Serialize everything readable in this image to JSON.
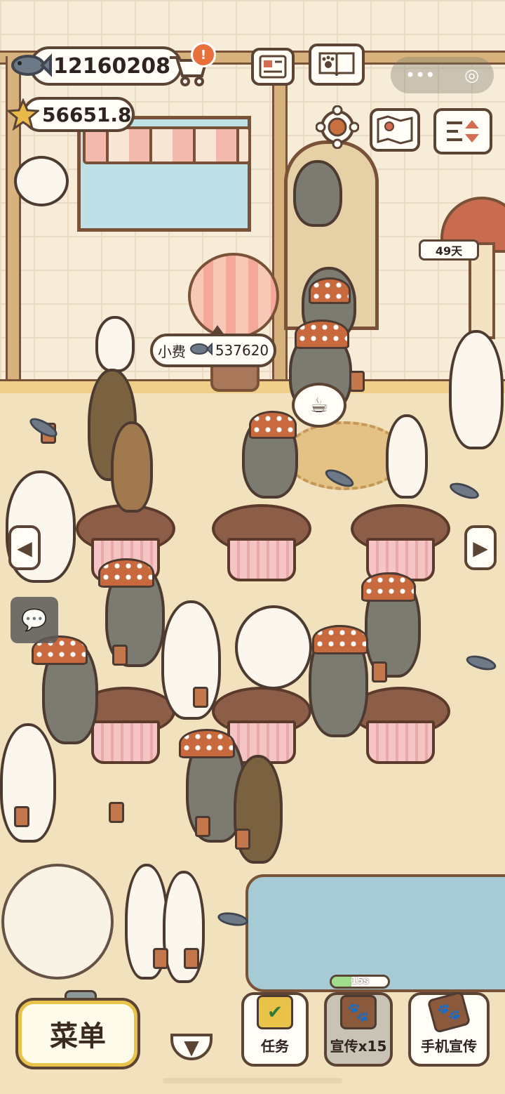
{
  "hud": {
    "fish_currency": "12160208",
    "star_currency": "56651.8",
    "days_label": "49天"
  },
  "tip_bubble": {
    "label": "小费",
    "amount": "537620"
  },
  "bottom_bar": {
    "menu_label": "菜单",
    "tasks_label": "任务",
    "promote_label": "宣传x15",
    "phone_promote_label": "手机宣传",
    "promote_timer": "15s",
    "promote_timer_fraction": 0.35
  },
  "colors": {
    "wall": "#f6ecd7",
    "floor": "#f1e1bd",
    "outline": "#5b4434",
    "menu_border": "#e9c24a",
    "timer_fill": "#9fdc8c",
    "alert_badge": "#e8703a"
  },
  "icons": {
    "fish": "fish-icon",
    "star": "star-icon",
    "cart": "cart-icon",
    "alert": "alert-badge-icon",
    "news": "newspaper-icon",
    "pawbook": "paw-book-icon",
    "settings": "gear-icon",
    "map": "map-icon",
    "sort": "sort-icon",
    "chat": "chat-icon",
    "coffee": "coffee-cup-icon"
  }
}
